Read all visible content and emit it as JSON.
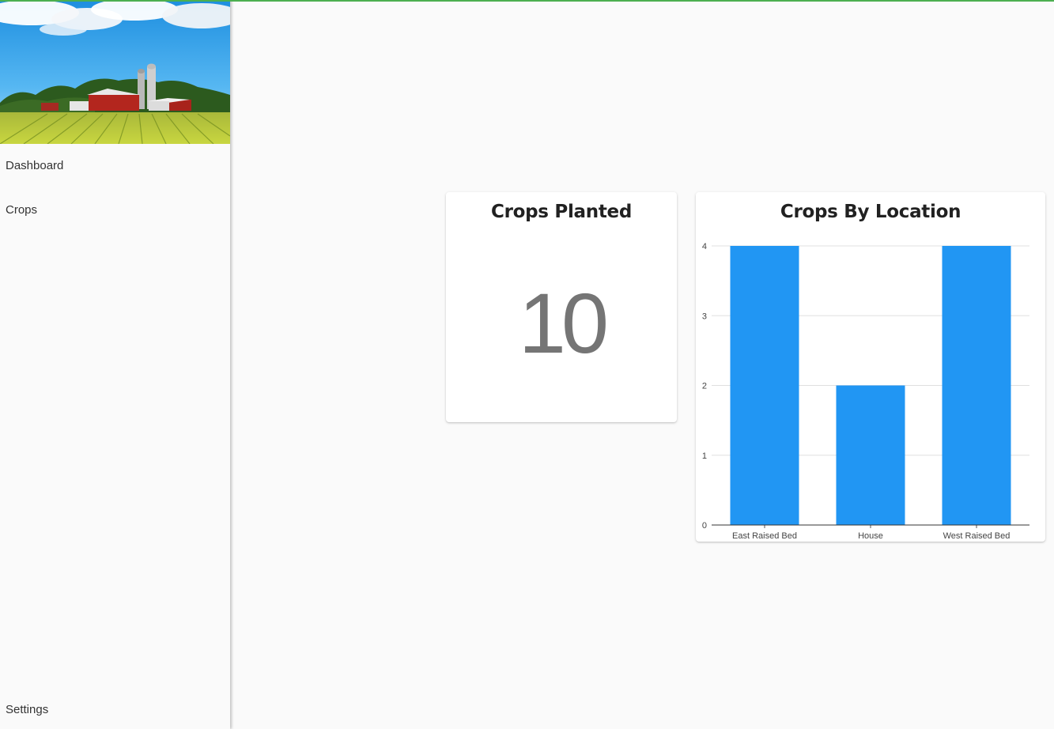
{
  "sidebar": {
    "items": [
      {
        "label": "Dashboard"
      },
      {
        "label": "Crops"
      }
    ],
    "settings_label": "Settings"
  },
  "cards": {
    "planted": {
      "title": "Crops Planted",
      "value": "10"
    },
    "location": {
      "title": "Crops By Location"
    }
  },
  "colors": {
    "accent": "#4caf50",
    "bar": "#2196f3"
  },
  "chart_data": {
    "type": "bar",
    "title": "Crops By Location",
    "categories": [
      "East Raised Bed",
      "House",
      "West Raised Bed"
    ],
    "values": [
      4,
      2,
      4
    ],
    "yticks": [
      0,
      1,
      2,
      3,
      4
    ],
    "ylim": [
      0,
      4
    ],
    "grid": true,
    "legend": "none"
  }
}
